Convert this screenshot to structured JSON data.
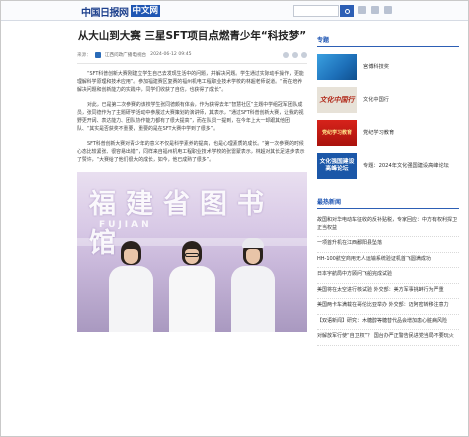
{
  "header": {
    "logo_cn": "中国日报网",
    "logo_tag": "中文网"
  },
  "article": {
    "title": "从大山到大赛 三星SFT项目点燃青少年“科技梦”",
    "meta": {
      "source_label": "来源：",
      "source": "江西问政广播电视台",
      "date": "2024-06-12 09:45"
    },
    "paragraphs": [
      "“SFT科普创新大赛刚建立学生自己去发现生活中的问题，并解决问题。学生通过实际动手操作，更能理解科学原理和技术应用”。参加福建赛区复赛的福州机电工程职业技术学校的林超老师说道。“而在培养解决问题和创新能力的实践中，同学们收获了自信，也获得了成长”。",
      "对此，已是第二次参赛的该校学生张同德颇有体会，作为获得去年“智慧社区”主题中学组冠军团队成员，张同德作为了主题研学活动中参展过大赛策划的演讲师，其表示，“通过SFT科普创新大赛，让我的视野更开阔、表达能力、团队协作能力都有了很大提高”，而在队员一提到，在今年上大一却跟其他团队、“其实是否获奖不重要，重要的是在SFT大赛中学到了很多”。",
      "SFT科普创新大赛对青少年的意义不仅是科学素养的提高，也是心理素质的成长。“第一次参赛的时候心态比较紧张、很容易出错”，同样来自福州机电工程职业技术学校的张雷蒙表示，林超对其长足进步表示了赞许，“大赛给了他们很大的成长，如今，他已成熟了很多”。"
    ],
    "photo": {
      "sign_text": "福建省图书馆",
      "sign_sub": "FUJIAN"
    }
  },
  "sidebar": {
    "section_title": "专题",
    "promos": [
      {
        "label": "宫博科技奖",
        "image_text": ""
      },
      {
        "label": "文化中国行",
        "image_text": "文化中国行"
      },
      {
        "label": "党纪学习教育",
        "image_text": "党纪学习教育"
      },
      {
        "label": "专题：2024年文化强国建设高峰论坛",
        "image_text": "文化强国建设高峰论坛"
      }
    ],
    "news_title": "最热新闻",
    "news": [
      "故国和对华电动车征收的反补贴税，专家回应：中方有权利捍卫正当权益",
      "一项首升机在江西鄱阳县坠落",
      "HH-100航空商用无人运输系统验证机首飞圆满成功",
      "日本宇航局中方顾问飞船完成试验",
      "美国将在太空进行核试验 外交部：美方军事挑衅行为严重",
      "美国两卡车满载在哥伦比亚举办 外交部：迈阿密转移注意力",
      "【双语新闻】研究：木糖醇等糖替代品会增加患心脏病风险",
      "对解放军行使“自卫权”？ 国台办严正警告民进党当局不要玩火"
    ]
  }
}
